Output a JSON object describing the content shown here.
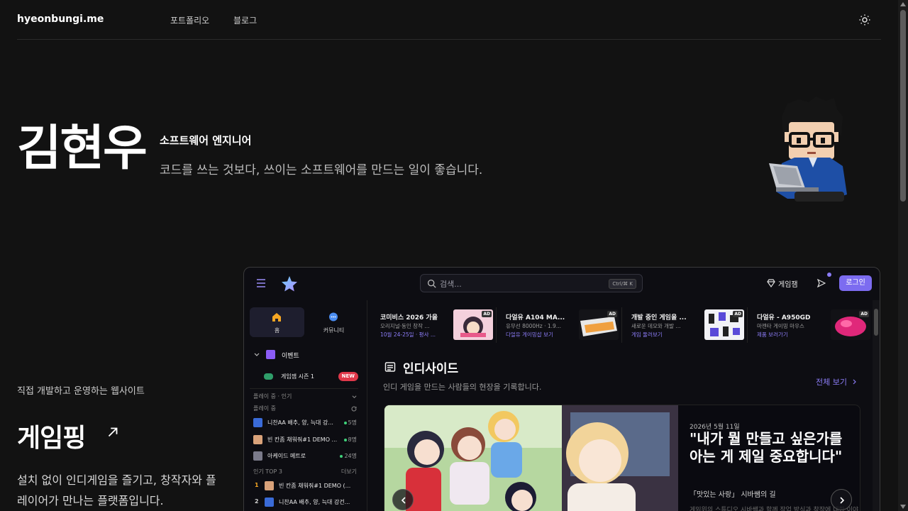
{
  "site": {
    "brand": "hyeonbungi.me",
    "nav": [
      "포트폴리오",
      "블로그"
    ]
  },
  "hero": {
    "name": "김현우",
    "role": "소프트웨어 엔지니어",
    "tagline": "코드를 쓰는 것보다, 쓰이는 소프트웨어를 만드는 일이 좋습니다."
  },
  "project": {
    "label": "직접 개발하고 운영하는 웹사이트",
    "title": "게임핑",
    "description": "설치 없이 인디게임을 즐기고, 창작자와 플레이어가 만나는 플랫폼입니다."
  },
  "app": {
    "search_placeholder": "검색...",
    "shortcut": "Ctrl/⌘ K",
    "gem_label": "게임잼",
    "login": "로그인",
    "accent": "#7c6cf0",
    "sidebar": {
      "tabs": [
        "홈",
        "커뮤니티"
      ],
      "event_label": "이벤트",
      "event_item": "게임잼 시즌 1",
      "new_badge": "NEW",
      "playing_popular": "플레이 중 · 인기",
      "playing": "플레이 중",
      "playing_items": [
        {
          "name": "니찬AA 배추, 양, 늑대 강...",
          "count": "5명"
        },
        {
          "name": "빈 칸좀 채워줘#1 DEMO ...",
          "count": "8명"
        },
        {
          "name": "아케이드 메트로",
          "count": "24명"
        }
      ],
      "top3_label": "인기 TOP 3",
      "more": "더보기",
      "top_items": [
        {
          "rank": "1",
          "name": "빈 칸좀 채워줘#1 DEMO (..."
        },
        {
          "rank": "2",
          "name": "니찬AA 배추, 양, 늑대 강건..."
        }
      ]
    },
    "ads": [
      {
        "title": "코미비스 2026 가을",
        "sub": "오리지널·동인 창작 ...",
        "link": "10월 24-25일 · 평사 ...",
        "badge": "AD"
      },
      {
        "title": "다얼유 A104 MA...",
        "sub": "유무선 8000Hz · 1.9...",
        "link": "다얼유 게이밍샵 보기",
        "badge": "AD"
      },
      {
        "title": "개발 중인 게임을 ...",
        "sub": "새로운 데모와 개발 ...",
        "link": "게임 둘러보기",
        "badge": "AD"
      },
      {
        "title": "다얼유 - A950GD",
        "sub": "마젠타 게이밍 마우스",
        "link": "제품 보러가기",
        "badge": "AD"
      }
    ],
    "section": {
      "title": "인디사이드",
      "description": "인디 게임을 만드는 사람들의 현장을 기록합니다.",
      "more": "전체 보기"
    },
    "feature": {
      "date": "2026년 5월 11일",
      "quote": "\"내가 뭘 만들고 싶은가를 아는 게 제일 중요합니다\"",
      "subtitle": "「맛있는 사랑」 시바쌤의 길",
      "excerpt": "게임위의 스튜디오 시바쌤과 함께 작업 방식과 창작에 대한 이야기"
    }
  }
}
